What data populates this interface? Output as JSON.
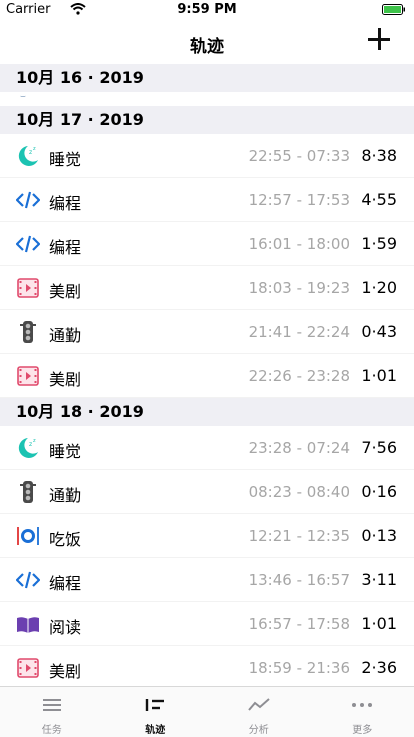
{
  "status_bar": {
    "carrier": "Carrier",
    "time": "9:59 PM"
  },
  "nav": {
    "title": "轨迹"
  },
  "sections": [
    {
      "header": "10月 16 · 2019",
      "rows": []
    },
    {
      "header": "10月 17 · 2019",
      "rows": [
        {
          "icon": "moon-icon",
          "label": "睡觉",
          "range": "22:55 - 07:33",
          "duration": "8·38"
        },
        {
          "icon": "code-icon",
          "label": "编程",
          "range": "12:57 - 17:53",
          "duration": "4·55"
        },
        {
          "icon": "code-icon",
          "label": "编程",
          "range": "16:01 - 18:00",
          "duration": "1·59"
        },
        {
          "icon": "film-icon",
          "label": "美剧",
          "range": "18:03 - 19:23",
          "duration": "1·20"
        },
        {
          "icon": "traffic-light-icon",
          "label": "通勤",
          "range": "21:41 - 22:24",
          "duration": "0·43"
        },
        {
          "icon": "film-icon",
          "label": "美剧",
          "range": "22:26 - 23:28",
          "duration": "1·01"
        }
      ]
    },
    {
      "header": "10月 18 · 2019",
      "rows": [
        {
          "icon": "moon-icon",
          "label": "睡觉",
          "range": "23:28 - 07:24",
          "duration": "7·56"
        },
        {
          "icon": "traffic-light-icon",
          "label": "通勤",
          "range": "08:23 - 08:40",
          "duration": "0·16"
        },
        {
          "icon": "dining-icon",
          "label": "吃饭",
          "range": "12:21 - 12:35",
          "duration": "0·13"
        },
        {
          "icon": "code-icon",
          "label": "编程",
          "range": "13:46 - 16:57",
          "duration": "3·11"
        },
        {
          "icon": "book-icon",
          "label": "阅读",
          "range": "16:57 - 17:58",
          "duration": "1·01"
        },
        {
          "icon": "film-icon",
          "label": "美剧",
          "range": "18:59 - 21:36",
          "duration": "2·36"
        }
      ]
    }
  ],
  "tabs": [
    {
      "label": "任务",
      "icon": "list-icon",
      "active": false
    },
    {
      "label": "轨迹",
      "icon": "timeline-icon",
      "active": true
    },
    {
      "label": "分析",
      "icon": "chart-icon",
      "active": false
    },
    {
      "label": "更多",
      "icon": "more-icon",
      "active": false
    }
  ],
  "colors": {
    "accent": "#1cc3b2",
    "code": "#1a6fd6",
    "film": "#e04a6c",
    "traffic": "#4a4a4a",
    "book": "#6b3fb0"
  }
}
